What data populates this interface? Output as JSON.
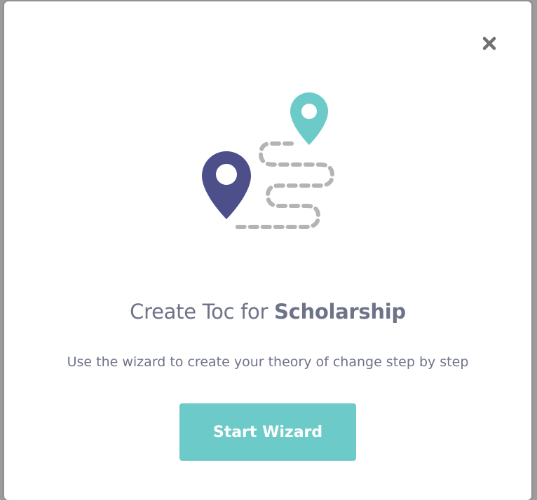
{
  "modal": {
    "title_prefix": "Create Toc for ",
    "title_subject": "Scholarship",
    "subtitle": "Use the wizard to create your theory of change step by step",
    "start_button_label": "Start Wizard",
    "close_icon": "close-icon",
    "illustration_icon": "route-map-pins-icon"
  },
  "colors": {
    "accent": "#6ccbc8",
    "pin_dark": "#4d4f8a",
    "pin_light": "#6ccbc8",
    "path_dash": "#b4b4b4",
    "text": "#6f7388"
  }
}
